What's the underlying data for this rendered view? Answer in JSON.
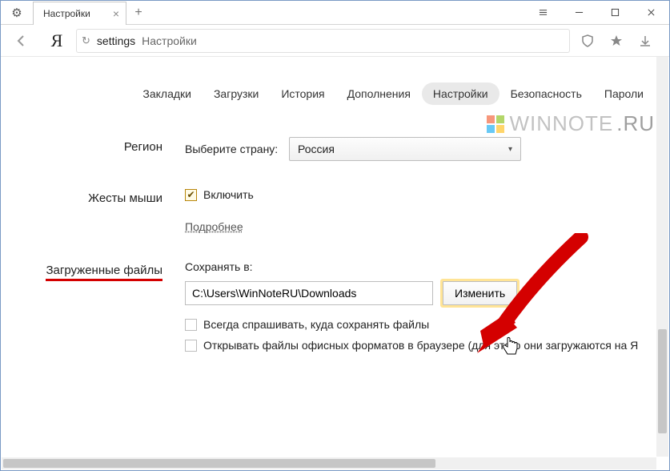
{
  "titlebar": {
    "tab_title": "Настройки"
  },
  "addr": {
    "keyword": "settings",
    "label": "Настройки"
  },
  "nav": {
    "items": [
      "Закладки",
      "Загрузки",
      "История",
      "Дополнения",
      "Настройки",
      "Безопасность",
      "Пароли"
    ],
    "active_index": 4
  },
  "watermark": {
    "text_a": "WINNOTE",
    "text_b": ".RU"
  },
  "region": {
    "label": "Регион",
    "prompt": "Выберите страну:",
    "value": "Россия"
  },
  "gestures": {
    "label": "Жесты мыши",
    "enable": "Включить",
    "more": "Подробнее"
  },
  "downloads": {
    "label": "Загруженные файлы",
    "save_to": "Сохранять в:",
    "path": "C:\\Users\\WinNoteRU\\Downloads",
    "change": "Изменить",
    "always_ask": "Всегда спрашивать, куда сохранять файлы",
    "open_office": "Открывать файлы офисных форматов в браузере (для этого они загружаются на Я"
  }
}
